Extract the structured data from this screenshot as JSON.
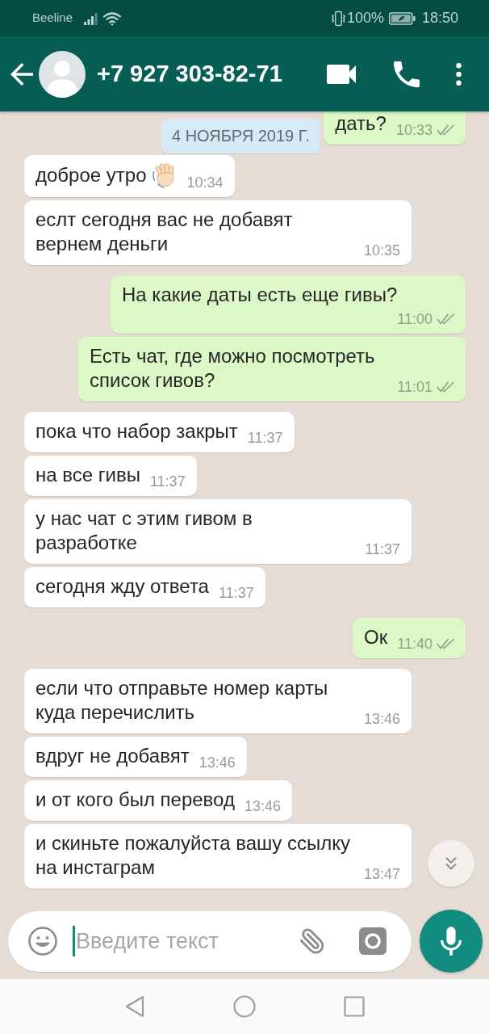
{
  "status_bar": {
    "carrier": "Beeline",
    "battery": "100%",
    "time": "18:50"
  },
  "header": {
    "title": "+7 927 303-82-71"
  },
  "date_chip": "4 НОЯБРЯ 2019 Г.",
  "messages": [
    {
      "outgoing": true,
      "kind": "text",
      "text": "дать?",
      "time": "10:33",
      "delivered": true,
      "read": false,
      "cut_off": true
    },
    {
      "outgoing": false,
      "kind": "wave",
      "text": "доброе утро",
      "time": "10:34",
      "cut_off": false
    },
    {
      "outgoing": false,
      "kind": "text",
      "text": "еслт сегодня вас не добавят\nвернем деньги",
      "time": "10:35",
      "cut_off": false
    },
    {
      "outgoing": true,
      "kind": "text",
      "text": "На какие даты есть еще гивы?",
      "time": "11:00",
      "delivered": true,
      "read": false,
      "cut_off": false
    },
    {
      "outgoing": true,
      "kind": "text",
      "text": "Есть чат, где можно посмотреть\nсписок гивов?",
      "time": "11:01",
      "delivered": true,
      "read": false,
      "cut_off": false
    },
    {
      "outgoing": false,
      "kind": "text",
      "text": "пока что набор закрыт",
      "time": "11:37",
      "cut_off": false
    },
    {
      "outgoing": false,
      "kind": "text",
      "text": "на все гивы",
      "time": "11:37",
      "cut_off": false
    },
    {
      "outgoing": false,
      "kind": "text",
      "text": "у нас чат с этим гивом в\nразработке",
      "time": "11:37",
      "cut_off": false
    },
    {
      "outgoing": false,
      "kind": "text",
      "text": "сегодня жду ответа",
      "time": "11:37",
      "cut_off": false
    },
    {
      "outgoing": true,
      "kind": "text",
      "text": "Ок",
      "time": "11:40",
      "delivered": true,
      "read": false,
      "cut_off": false
    },
    {
      "outgoing": false,
      "kind": "text",
      "text": "если что отправьте номер карты\nкуда перечислить",
      "time": "13:46",
      "cut_off": false
    },
    {
      "outgoing": false,
      "kind": "text",
      "text": "вдруг не добавят",
      "time": "13:46",
      "cut_off": false
    },
    {
      "outgoing": false,
      "kind": "text",
      "text": "и от кого был перевод",
      "time": "13:46",
      "cut_off": false
    },
    {
      "outgoing": false,
      "kind": "text",
      "text": "и скиньте пожалуйста вашу ссылку\nна инстаграм",
      "time": "13:47",
      "cut_off": false
    }
  ],
  "composer": {
    "placeholder": "Введите текст"
  }
}
